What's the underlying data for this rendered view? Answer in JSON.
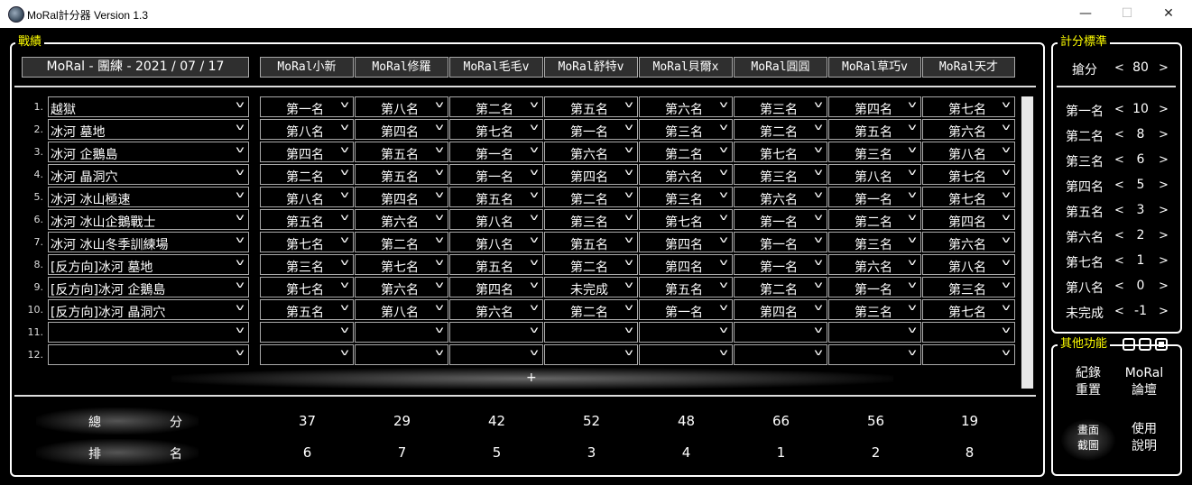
{
  "window": {
    "title": "MoRal計分器 Version 1.3",
    "minimize": "—",
    "maximize": "☐",
    "close": "✕"
  },
  "records": {
    "section_title": "戰績",
    "date_header": "MoRal - 團練 - 2021 / 07 / 17",
    "players": [
      "MoRal小新",
      "MoRal修羅",
      "MoRal毛毛v",
      "MoRal舒特v",
      "MoRal貝爾x",
      "MoRal圓圓",
      "MoRal草巧v",
      "MoRal天才"
    ],
    "rows": [
      {
        "num": "1.",
        "map": "越獄",
        "ranks": [
          "第一名",
          "第八名",
          "第二名",
          "第五名",
          "第六名",
          "第三名",
          "第四名",
          "第七名"
        ]
      },
      {
        "num": "2.",
        "map": "冰河 墓地",
        "ranks": [
          "第八名",
          "第四名",
          "第七名",
          "第一名",
          "第三名",
          "第二名",
          "第五名",
          "第六名"
        ]
      },
      {
        "num": "3.",
        "map": "冰河 企鵝島",
        "ranks": [
          "第四名",
          "第五名",
          "第一名",
          "第六名",
          "第二名",
          "第七名",
          "第三名",
          "第八名"
        ]
      },
      {
        "num": "4.",
        "map": "冰河 晶洞穴",
        "ranks": [
          "第二名",
          "第五名",
          "第一名",
          "第四名",
          "第六名",
          "第三名",
          "第八名",
          "第七名"
        ]
      },
      {
        "num": "5.",
        "map": "冰河 冰山極速",
        "ranks": [
          "第八名",
          "第四名",
          "第五名",
          "第二名",
          "第三名",
          "第六名",
          "第一名",
          "第七名"
        ]
      },
      {
        "num": "6.",
        "map": "冰河 冰山企鵝戰士",
        "ranks": [
          "第五名",
          "第六名",
          "第八名",
          "第三名",
          "第七名",
          "第一名",
          "第二名",
          "第四名"
        ]
      },
      {
        "num": "7.",
        "map": "冰河 冰山冬季訓練場",
        "ranks": [
          "第七名",
          "第二名",
          "第八名",
          "第五名",
          "第四名",
          "第一名",
          "第三名",
          "第六名"
        ]
      },
      {
        "num": "8.",
        "map": "[反方向]冰河 墓地",
        "ranks": [
          "第三名",
          "第七名",
          "第五名",
          "第二名",
          "第四名",
          "第一名",
          "第六名",
          "第八名"
        ]
      },
      {
        "num": "9.",
        "map": "[反方向]冰河 企鵝島",
        "ranks": [
          "第七名",
          "第六名",
          "第四名",
          "未完成",
          "第五名",
          "第二名",
          "第一名",
          "第三名"
        ]
      },
      {
        "num": "10.",
        "map": "[反方向]冰河 晶洞穴",
        "ranks": [
          "第五名",
          "第八名",
          "第六名",
          "第二名",
          "第一名",
          "第四名",
          "第三名",
          "第七名"
        ]
      },
      {
        "num": "11.",
        "map": "",
        "ranks": [
          "",
          "",
          "",
          "",
          "",
          "",
          "",
          ""
        ]
      },
      {
        "num": "12.",
        "map": "",
        "ranks": [
          "",
          "",
          "",
          "",
          "",
          "",
          "",
          ""
        ]
      }
    ],
    "add_row_label": "+",
    "total_label": [
      "總",
      "分"
    ],
    "rank_label": [
      "排",
      "名"
    ],
    "totals": [
      "37",
      "29",
      "42",
      "52",
      "48",
      "66",
      "56",
      "19"
    ],
    "rankings": [
      "6",
      "7",
      "5",
      "3",
      "4",
      "1",
      "2",
      "8"
    ]
  },
  "scoring": {
    "section_title": "計分標準",
    "left_arrow": "<",
    "right_arrow": ">",
    "snatch": {
      "label": "搶分",
      "value": "80"
    },
    "places": [
      {
        "label": "第一名",
        "value": "10"
      },
      {
        "label": "第二名",
        "value": "8"
      },
      {
        "label": "第三名",
        "value": "6"
      },
      {
        "label": "第四名",
        "value": "5"
      },
      {
        "label": "第五名",
        "value": "3"
      },
      {
        "label": "第六名",
        "value": "2"
      },
      {
        "label": "第七名",
        "value": "1"
      },
      {
        "label": "第八名",
        "value": "0"
      },
      {
        "label": "未完成",
        "value": "-1"
      }
    ]
  },
  "other": {
    "section_title": "其他功能",
    "reset_records": [
      "紀錄",
      "重置"
    ],
    "forum": [
      "MoRal",
      "論壇"
    ],
    "screenshot": [
      "畫面",
      "截圖"
    ],
    "help": [
      "使用",
      "說明"
    ]
  },
  "icons": {
    "app": "app-logo-icon",
    "dropdown": "chevron-down-icon"
  },
  "colors": {
    "background": "#000000",
    "section_title": "#ffff00",
    "border": "#ffffff",
    "header_bg": "#2f2f2f"
  }
}
